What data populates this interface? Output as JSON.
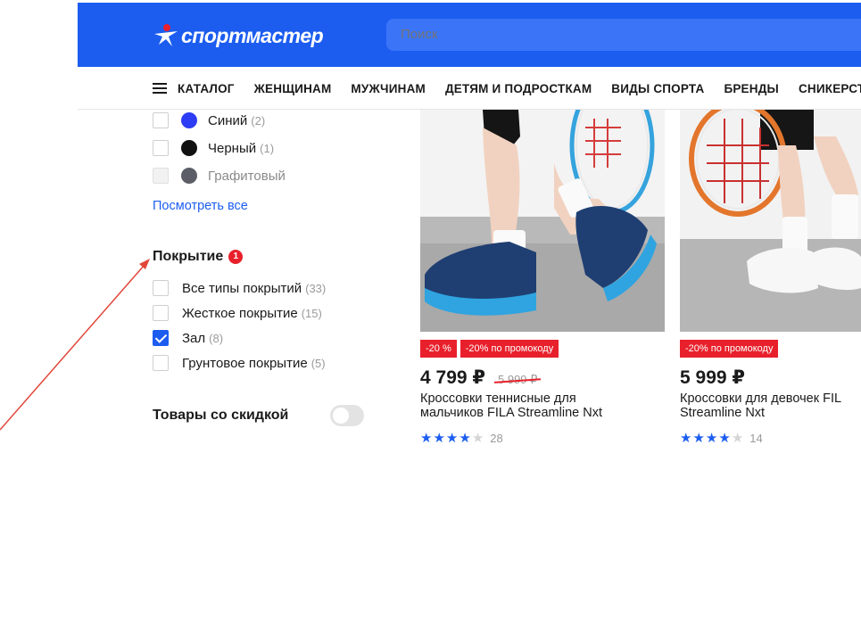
{
  "header": {
    "logo_text": "спортмастер",
    "search_placeholder": "Поиск",
    "brand_color": "#1c5df0"
  },
  "nav": {
    "menu_icon": "hamburger-icon",
    "items": [
      "КАТАЛОГ",
      "ЖЕНЩИНАМ",
      "МУЖЧИНАМ",
      "ДЕТЯМ И ПОДРОСТКАМ",
      "ВИДЫ СПОРТА",
      "БРЕНДЫ",
      "СНИКЕРСТ"
    ]
  },
  "filters": {
    "colors": [
      {
        "label": "Синий",
        "count": "(2)",
        "swatch": "#2d3cf5"
      },
      {
        "label": "Черный",
        "count": "(1)",
        "swatch": "#111111"
      },
      {
        "label": "Графитовый",
        "count": "",
        "swatch": "#5b5e66"
      }
    ],
    "show_all": "Посмотреть все",
    "coverage": {
      "title": "Покрытие",
      "badge": "1",
      "options": [
        {
          "label": "Все типы покрытий",
          "count": "(33)",
          "checked": false
        },
        {
          "label": "Жесткое покрытие",
          "count": "(15)",
          "checked": false
        },
        {
          "label": "Зал",
          "count": "(8)",
          "checked": true
        },
        {
          "label": "Грунтовое покрытие",
          "count": "(5)",
          "checked": false
        }
      ]
    },
    "discount_toggle": {
      "label": "Товары со скидкой",
      "on": false
    }
  },
  "products": [
    {
      "tags": [
        "-20 %",
        "-20% по промокоду"
      ],
      "price": "4 799 ₽",
      "old_price": "5 999 ₽",
      "title_line1": "Кроссовки теннисные для",
      "title_line2": "мальчиков FILA Streamline Nxt",
      "rating": 4,
      "reviews": "28"
    },
    {
      "tags": [
        "-20% по промокоду"
      ],
      "price": "5 999 ₽",
      "old_price": "",
      "title_line1": "Кроссовки для девочек FIL",
      "title_line2": "Streamline Nxt",
      "rating": 4,
      "reviews": "14"
    }
  ]
}
